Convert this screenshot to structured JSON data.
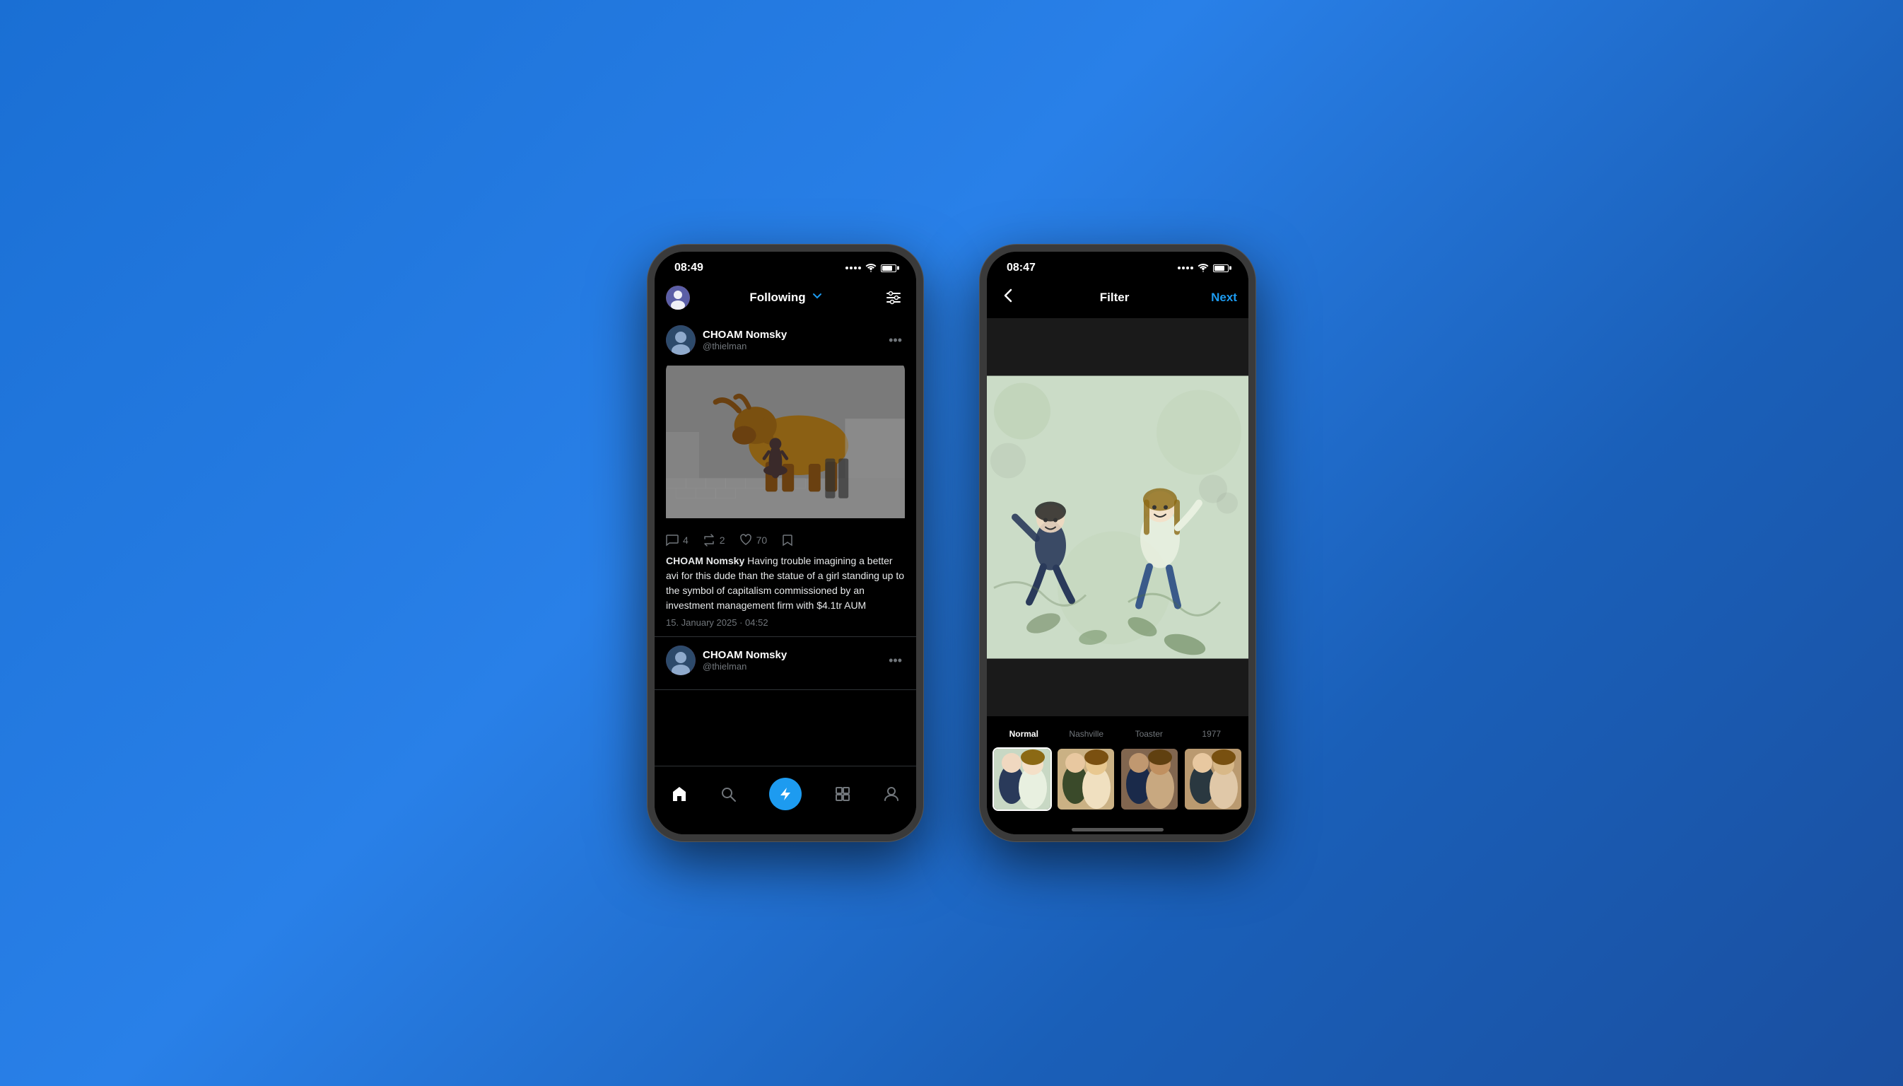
{
  "background": {
    "gradient": "blue radial"
  },
  "phone1": {
    "status_bar": {
      "time": "08:49",
      "signal_dots": 4,
      "wifi": "wifi",
      "battery": "battery"
    },
    "header": {
      "following_label": "Following",
      "chevron": "▾",
      "filter_icon": "filter"
    },
    "tweet1": {
      "display_name": "CHOAM Nomsky",
      "username": "@thielman",
      "more": "•••",
      "comments": "4",
      "retweets": "2",
      "likes": "70",
      "bookmark": "bookmark",
      "text_prefix": "CHOAM Nomsky",
      "text_body": " Having trouble imagining a better avi for this dude than the statue of a girl standing up to the symbol of capitalism commissioned by an investment management firm with $4.1tr AUM",
      "timestamp": "15. January 2025 · 04:52"
    },
    "tweet2": {
      "display_name": "CHOAM Nomsky",
      "username": "@thielman",
      "more": "•••"
    },
    "bottom_nav": {
      "home": "⌂",
      "search": "⌕",
      "bolt": "⚡",
      "squares": "☐",
      "person": "◯"
    }
  },
  "phone2": {
    "status_bar": {
      "time": "08:47",
      "signal_dots": 4,
      "wifi": "wifi",
      "battery": "battery"
    },
    "nav": {
      "back": "‹",
      "title": "Filter",
      "next": "Next"
    },
    "filters": [
      {
        "name": "Normal",
        "active": true
      },
      {
        "name": "Nashville",
        "active": false
      },
      {
        "name": "Toaster",
        "active": false
      },
      {
        "name": "1977",
        "active": false
      }
    ]
  }
}
